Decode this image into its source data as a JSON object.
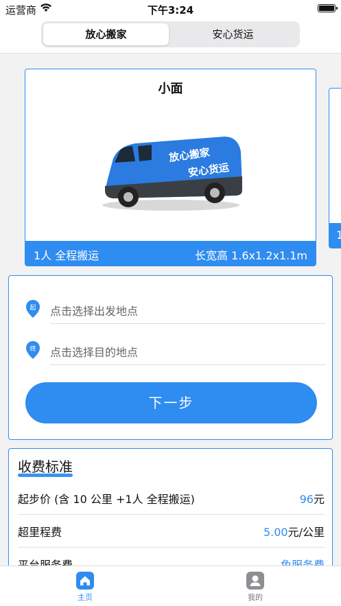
{
  "status": {
    "carrier": "运营商",
    "time": "下午3:24"
  },
  "segment": {
    "left": "放心搬家",
    "right": "安心货运"
  },
  "vehicle": {
    "title": "小面",
    "van_text_1": "放心搬家",
    "van_text_2": "安心货运",
    "people": "1人 全程搬运",
    "dimensions": "长宽高 1.6x1.2x1.1m",
    "peek_label": "1"
  },
  "address": {
    "start_badge": "起",
    "end_badge": "终",
    "start_placeholder": "点击选择出发地点",
    "end_placeholder": "点击选择目的地点",
    "next_label": "下一步"
  },
  "fees": {
    "title": "收费标准",
    "rows": [
      {
        "label": "起步价 (含 10 公里 +1人 全程搬运)",
        "value": "96",
        "unit": "元"
      },
      {
        "label": "超里程费",
        "value": "5.00",
        "unit": "元/公里"
      },
      {
        "label": "平台服务费",
        "value": "免服务费",
        "unit": ""
      }
    ]
  },
  "tabs": {
    "home": "主页",
    "mine": "我的"
  },
  "colors": {
    "accent": "#2f8cf0"
  },
  "icons": [
    "wifi-icon",
    "battery-icon",
    "location-pin-icon",
    "home-icon",
    "user-icon"
  ]
}
